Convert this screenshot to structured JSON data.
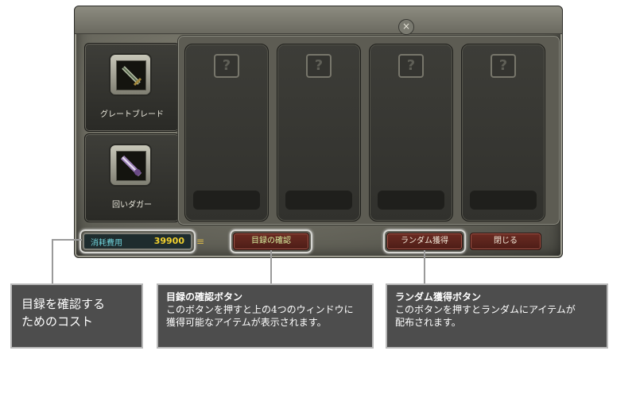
{
  "window": {
    "close_icon": "×"
  },
  "items": [
    {
      "name": "グレートブレード",
      "icon": "sword-icon"
    },
    {
      "name": "回いダガー",
      "icon": "dagger-icon"
    }
  ],
  "slots": [
    {
      "symbol": "?"
    },
    {
      "symbol": "?"
    },
    {
      "symbol": "?"
    },
    {
      "symbol": "?"
    }
  ],
  "bottom": {
    "cost_label": "消耗費用",
    "cost_value": "39900",
    "confirm_label": "目録の確認",
    "random_label": "ランダム獲得",
    "close_label": "閉じる"
  },
  "annotations": {
    "cost_note": {
      "line1": "目録を確認する",
      "line2": "ためのコスト"
    },
    "confirm_note": {
      "title": "目録の確認ボタン",
      "line1": "このボタンを押すと上の4つのウィンドウに",
      "line2": "獲得可能なアイテムが表示されます。"
    },
    "random_note": {
      "title": "ランダム獲得ボタン",
      "line1": "このボタンを押すとランダムにアイテムが",
      "line2": "配布されます。"
    }
  },
  "colors": {
    "cost_value": "#f2d12e",
    "cost_label": "#6fd0d8",
    "button_bg": "#5b241c"
  }
}
